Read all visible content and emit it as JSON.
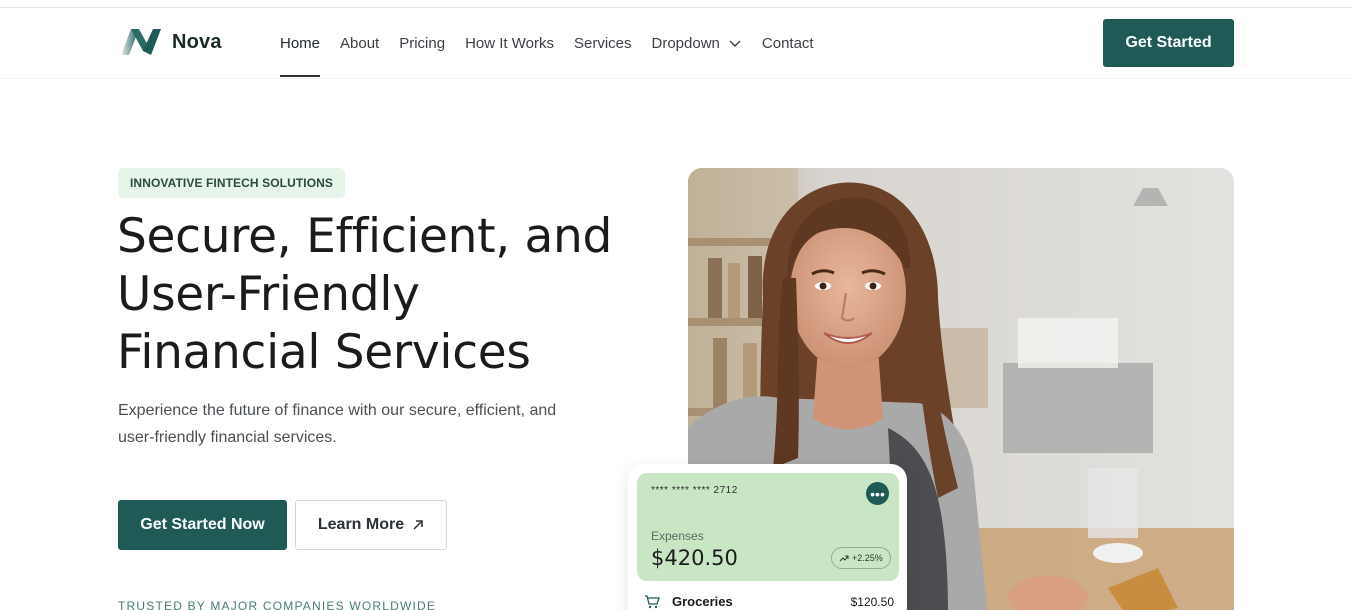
{
  "brand": {
    "name": "Nova",
    "accent": "#1f5a57",
    "badge_bg": "#e6f4ea",
    "card_bg": "#c8e6c4"
  },
  "nav": {
    "items": [
      {
        "label": "Home",
        "active": true
      },
      {
        "label": "About"
      },
      {
        "label": "Pricing"
      },
      {
        "label": "How It Works"
      },
      {
        "label": "Services"
      },
      {
        "label": "Dropdown",
        "icon": "chevron-down-icon"
      },
      {
        "label": "Contact"
      }
    ],
    "cta": "Get Started"
  },
  "hero": {
    "badge": "INNOVATIVE FINTECH SOLUTIONS",
    "title_lines": [
      "Secure, Efficient, and",
      "User-Friendly",
      "Financial Services"
    ],
    "subtitle_lines": [
      "Experience the future of finance with our secure, efficient, and",
      "user-friendly financial services."
    ],
    "primary_button": "Get Started Now",
    "secondary_button": "Learn More",
    "secondary_icon": "arrow-up-right-icon",
    "trusted": "TRUSTED BY MAJOR COMPANIES WORLDWIDE"
  },
  "card": {
    "number": "**** **** ****  2712",
    "menu_icon": "more-dots-icon",
    "label": "Expenses",
    "amount": "$420.50",
    "change": "+2.25%",
    "change_icon": "trend-up-icon",
    "transaction": {
      "name": "Groceries",
      "amount": "$120.50",
      "icon": "cart-icon"
    }
  }
}
